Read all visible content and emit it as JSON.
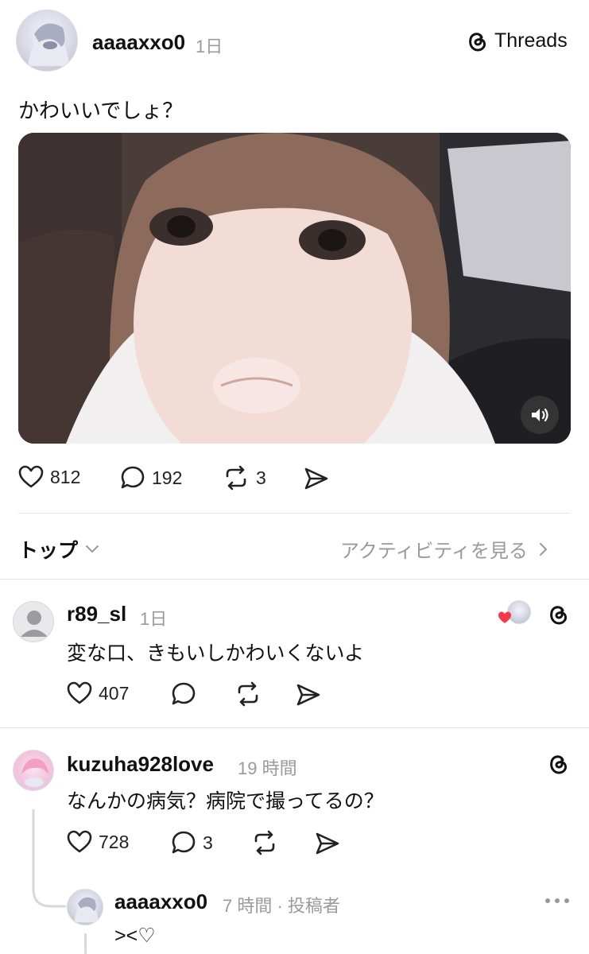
{
  "post": {
    "username": "aaaaxxo0",
    "time": "1日",
    "brand": "Threads",
    "caption": "かわいいでしょ？",
    "likes": "812",
    "replies": "192",
    "reposts": "3"
  },
  "sort": {
    "label": "トップ",
    "activity_link": "アクティビティを見る"
  },
  "comments": [
    {
      "username": "r89_sl",
      "time": "1日",
      "text": "変な口、きもいしかわいくないよ",
      "likes": "407"
    },
    {
      "username": "kuzuha928love",
      "time": "19 時間",
      "text": "なんかの病気？病院で撮ってるの？",
      "likes": "728",
      "replies": "3"
    }
  ],
  "reply": {
    "username": "aaaaxxo0",
    "time": "7 時間 · 投稿者",
    "text": "><♡"
  },
  "icons": [
    "heart-icon",
    "comment-icon",
    "repost-icon",
    "share-icon",
    "threads-logo-icon",
    "volume-icon",
    "chevron-down-icon",
    "chevron-right-icon",
    "more-icon"
  ]
}
